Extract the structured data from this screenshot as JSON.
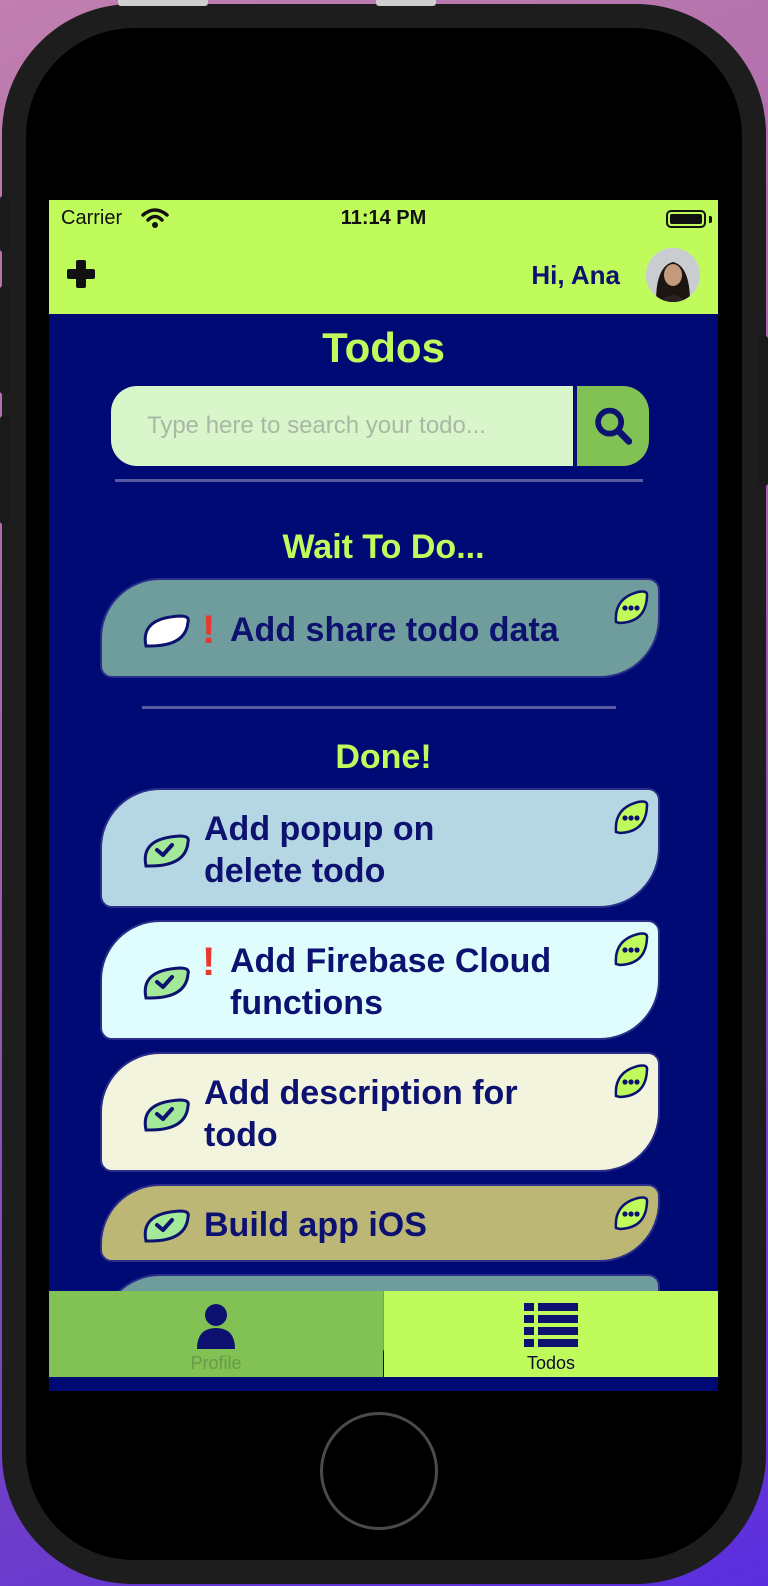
{
  "status_bar": {
    "carrier": "Carrier",
    "time": "11:14 PM"
  },
  "header": {
    "greeting": "Hi, Ana",
    "add_icon": "plus-icon",
    "avatar": "user-avatar-photo"
  },
  "page": {
    "title": "Todos",
    "search_placeholder": "Type here to search your todo...",
    "search_icon": "search-icon"
  },
  "sections": {
    "wait": {
      "title": "Wait To Do..."
    },
    "done": {
      "title": "Done!"
    }
  },
  "wait_todos": [
    {
      "line1": "Add share todo data",
      "line2": "",
      "priority": "!",
      "checked": false,
      "color": "#6f9c9c"
    }
  ],
  "done_todos": [
    {
      "line1": "Add popup on",
      "line2": "delete todo",
      "priority": "",
      "checked": true,
      "color": "#b5d6e3"
    },
    {
      "line1": "Add Firebase Cloud",
      "line2": "functions",
      "priority": "!",
      "checked": true,
      "color": "#e0fdfe"
    },
    {
      "line1": "Add description for",
      "line2": "todo",
      "priority": "",
      "checked": true,
      "color": "#f3f4dd"
    },
    {
      "line1": "Build app iOS",
      "line2": "",
      "priority": "",
      "checked": true,
      "color": "#bdb776"
    }
  ],
  "tabbar": {
    "profile_label": "Profile",
    "todos_label": "Todos",
    "active": "Todos"
  },
  "colors": {
    "accent_lime": "#c0fb5c",
    "background_navy": "#000a75",
    "text_navy": "#0d1270",
    "check_green": "#a4e89a"
  }
}
